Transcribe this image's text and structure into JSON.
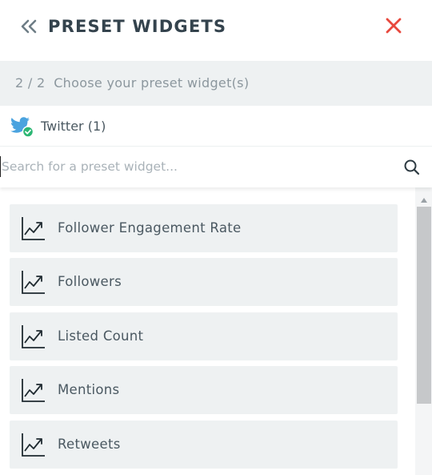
{
  "header": {
    "title": "PRESET WIDGETS",
    "back_icon": "double-chevron-left-icon",
    "close_icon": "close-icon",
    "close_color": "#e8483d"
  },
  "step": {
    "text": "2 / 2  Choose your preset widget(s)"
  },
  "source": {
    "label": "Twitter (1)",
    "icon": "twitter-icon",
    "twitter_color": "#4aa3df",
    "check_color": "#2bb673"
  },
  "search": {
    "value": "",
    "placeholder": "Search for a preset widget...",
    "icon": "search-icon"
  },
  "widgets": {
    "items": [
      {
        "label": "Follower Engagement Rate",
        "icon": "line-chart-icon"
      },
      {
        "label": "Followers",
        "icon": "line-chart-icon"
      },
      {
        "label": "Listed Count",
        "icon": "line-chart-icon"
      },
      {
        "label": "Mentions",
        "icon": "line-chart-icon"
      },
      {
        "label": "Retweets",
        "icon": "line-chart-icon"
      }
    ]
  }
}
